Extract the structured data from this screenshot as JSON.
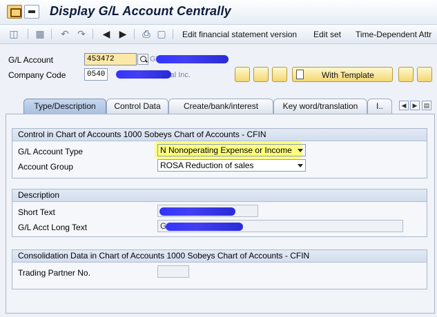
{
  "window": {
    "title": "Display G/L Account Centrally"
  },
  "toolbar": {
    "edit_fs_version": "Edit financial statement version",
    "edit_set": "Edit set",
    "time_dependent": "Time-Dependent Attr"
  },
  "header": {
    "gl_account_label": "G/L Account",
    "gl_account_value": "453472",
    "gl_account_desc_partial": "GL",
    "company_code_label": "Company Code",
    "company_code_value": "0540",
    "company_name_partial": "pital Inc.",
    "with_template_label": "With Template"
  },
  "tabs": [
    {
      "label": "Type/Description",
      "active": true
    },
    {
      "label": "Control Data",
      "active": false
    },
    {
      "label": "Create/bank/interest",
      "active": false
    },
    {
      "label": "Key word/translation",
      "active": false
    },
    {
      "label": "I..",
      "active": false
    }
  ],
  "control_group": {
    "title": "Control in Chart of Accounts 1000 Sobeys Chart of Accounts - CFIN",
    "account_type_label": "G/L Account Type",
    "account_type_value": "N Nonoperating Expense or Income",
    "account_group_label": "Account Group",
    "account_group_value": "ROSA Reduction of sales"
  },
  "description_group": {
    "title": "Description",
    "short_text_label": "Short Text",
    "short_text_value": "G",
    "long_text_label": "G/L Acct Long Text",
    "long_text_value": "G"
  },
  "consolidation_group": {
    "title": "Consolidation Data in Chart of Accounts 1000 Sobeys Chart of Accounts - CFIN",
    "trading_partner_label": "Trading Partner No.",
    "trading_partner_value": ""
  },
  "colors": {
    "highlight": "#ffff55",
    "redaction": "#2a2bff",
    "active_tab": "#a9c0e0"
  }
}
